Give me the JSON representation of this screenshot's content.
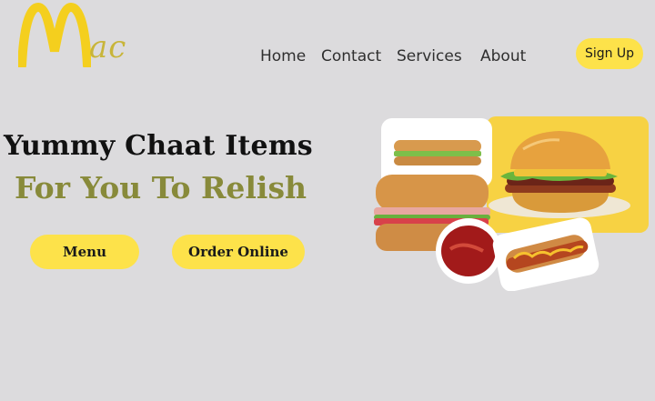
{
  "brand": {
    "letter": "M",
    "suffix": "ac"
  },
  "nav": {
    "items": [
      "Home",
      "Contact",
      "Services",
      "About"
    ],
    "signup_label": "Sign Up"
  },
  "hero": {
    "heading_line1": "Yummy Chaat Items",
    "heading_line2": "For You To Relish",
    "menu_button": "Menu",
    "order_button": "Order Online"
  },
  "colors": {
    "background": "#dcdbdd",
    "accent": "#fde24a",
    "olive": "#888a3a",
    "logo_yellow": "#f4cf1e"
  },
  "icons": [
    "mcdonalds-m-logo-icon",
    "sub-sandwich-icon",
    "burger-icon",
    "ketchup-bowl-icon",
    "hotdog-icon"
  ]
}
